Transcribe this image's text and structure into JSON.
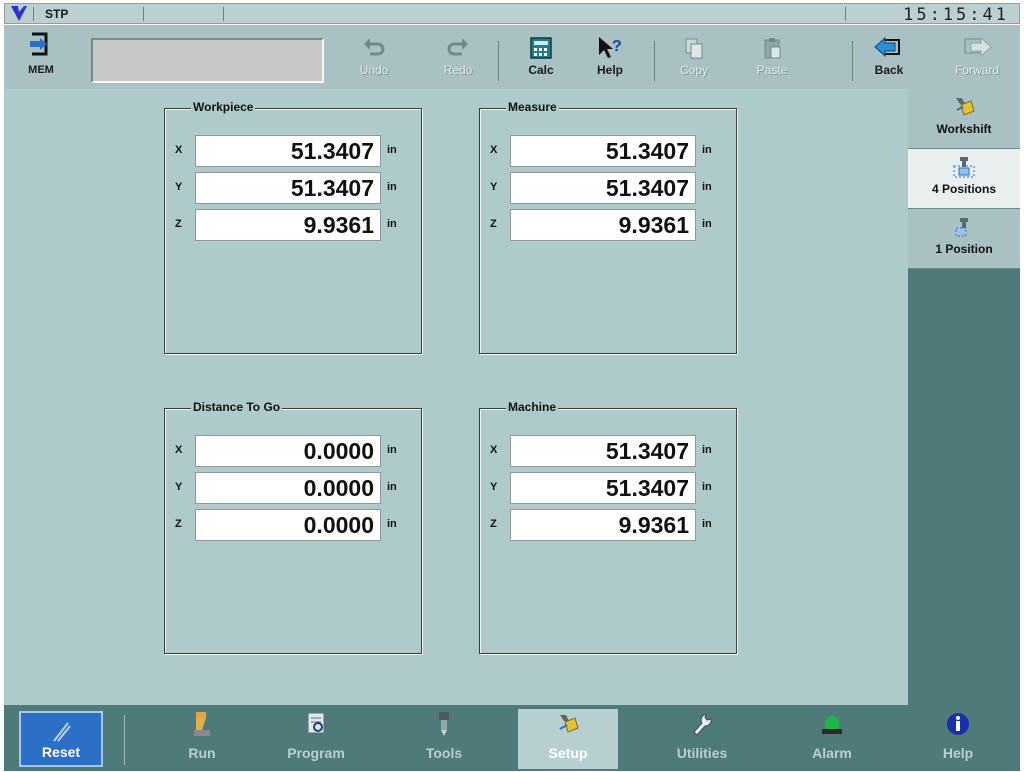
{
  "status": {
    "mode": "STP",
    "clock": "15:15:41"
  },
  "toolbar": {
    "mem_label": "MEM",
    "undo_label": "Undo",
    "redo_label": "Redo",
    "calc_label": "Calc",
    "help_label": "Help",
    "copy_label": "Copy",
    "paste_label": "Paste",
    "back_label": "Back",
    "forward_label": "Forward"
  },
  "groups": {
    "workpiece": {
      "title": "Workpiece",
      "x": "51.3407",
      "y": "51.3407",
      "z": "9.9361",
      "unit": "in"
    },
    "measure": {
      "title": "Measure",
      "x": "51.3407",
      "y": "51.3407",
      "z": "9.9361",
      "unit": "in"
    },
    "distance": {
      "title": "Distance To Go",
      "x": "0.0000",
      "y": "0.0000",
      "z": "0.0000",
      "unit": "in"
    },
    "machine": {
      "title": "Machine",
      "x": "51.3407",
      "y": "51.3407",
      "z": "9.9361",
      "unit": "in"
    }
  },
  "axes": {
    "x": "X",
    "y": "Y",
    "z": "Z"
  },
  "side_tabs": {
    "workshift": "Workshift",
    "four_positions": "4 Positions",
    "one_position": "1 Position"
  },
  "nav": {
    "reset": "Reset",
    "run": "Run",
    "program": "Program",
    "tools": "Tools",
    "setup": "Setup",
    "utilities": "Utilities",
    "alarm": "Alarm",
    "help": "Help"
  },
  "colors": {
    "accent_blue": "#2b6fc7",
    "panel": "#aecacb",
    "dark_teal": "#4e7a7a",
    "alarm_green": "#1fb44a"
  }
}
